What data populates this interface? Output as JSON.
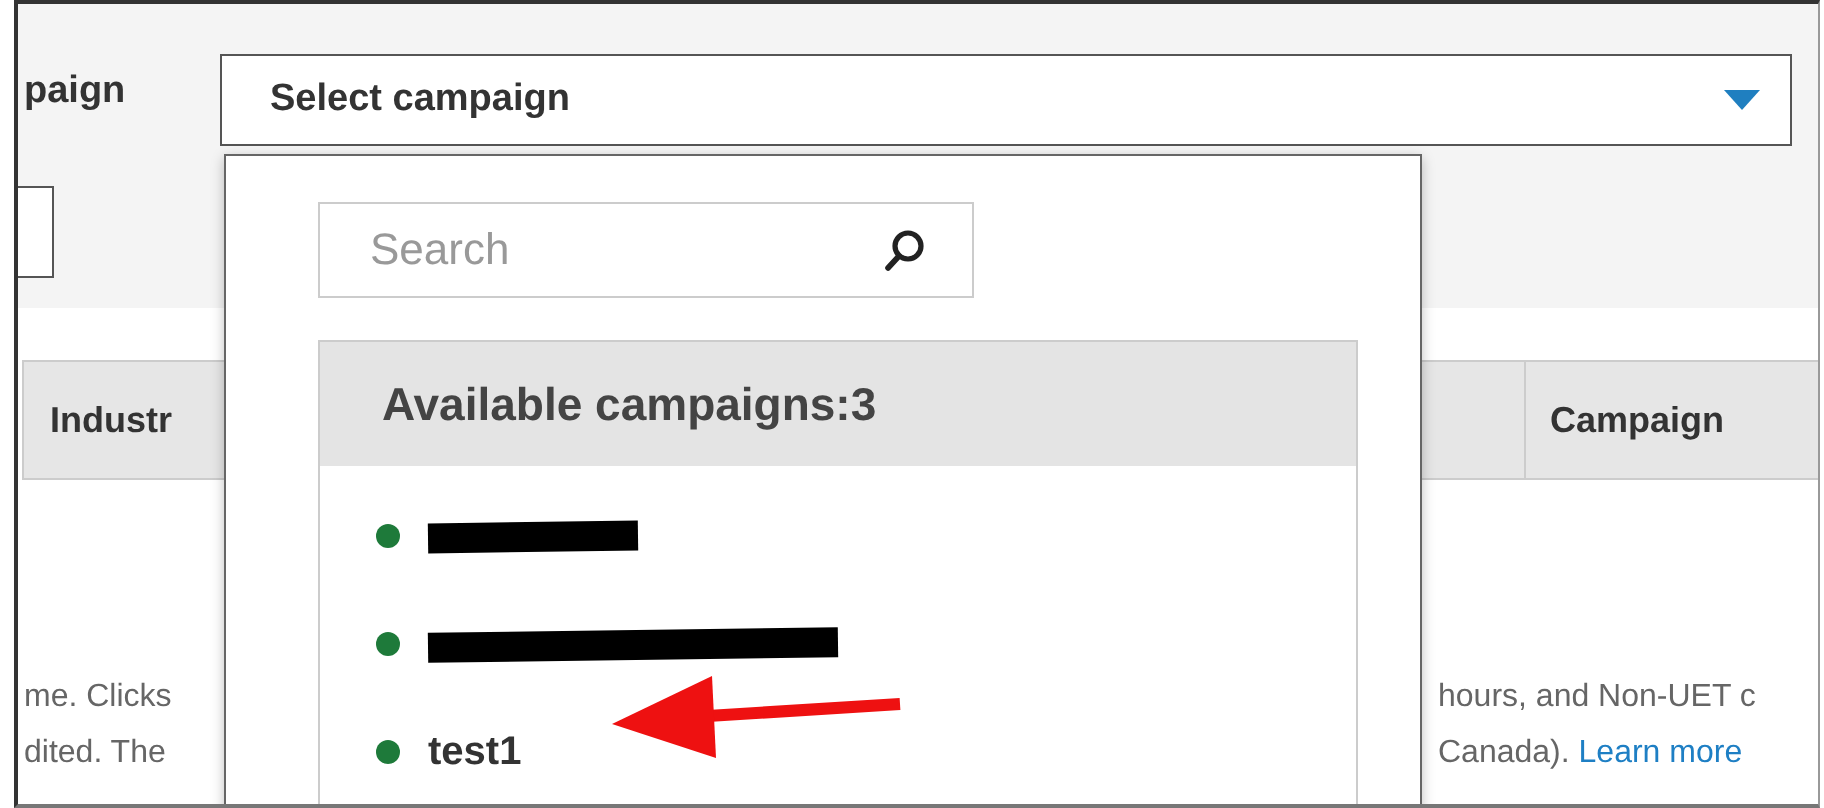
{
  "filter": {
    "label": "paign",
    "select": {
      "value": "Select campaign",
      "expanded": true
    }
  },
  "table": {
    "columns": [
      "Industr",
      "Campaign"
    ]
  },
  "notes": {
    "left": [
      "me. Clicks",
      "dited. The"
    ],
    "right": [
      "hours, and Non-UET c",
      "Canada). "
    ],
    "link": "Learn more"
  },
  "dropdown": {
    "search": {
      "placeholder": "Search"
    },
    "header": "Available campaigns:3",
    "campaigns": [
      {
        "kind": "redacted",
        "color": "#1e7a3a"
      },
      {
        "kind": "redacted",
        "color": "#1e7a3a"
      },
      {
        "kind": "text",
        "name": "test1",
        "color": "#1e7a3a"
      }
    ]
  },
  "annotation": {
    "kind": "arrow",
    "color": "#ee1111"
  }
}
